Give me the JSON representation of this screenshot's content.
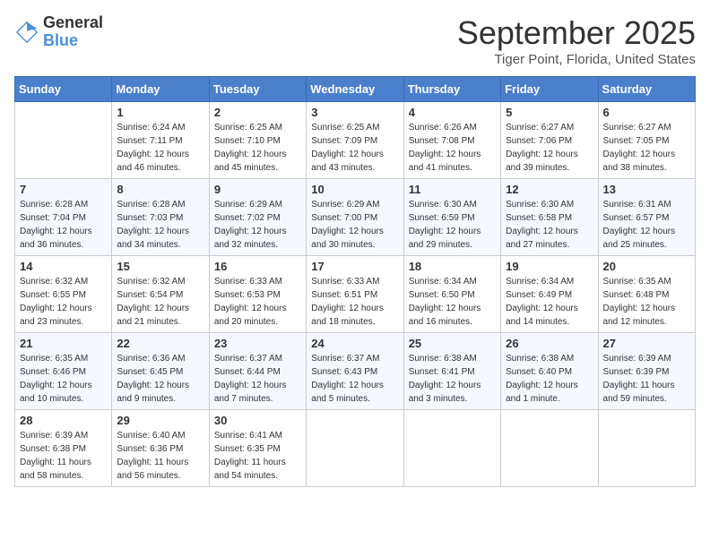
{
  "logo": {
    "general": "General",
    "blue": "Blue"
  },
  "header": {
    "month": "September 2025",
    "location": "Tiger Point, Florida, United States"
  },
  "weekdays": [
    "Sunday",
    "Monday",
    "Tuesday",
    "Wednesday",
    "Thursday",
    "Friday",
    "Saturday"
  ],
  "weeks": [
    [
      {
        "day": "",
        "info": ""
      },
      {
        "day": "1",
        "info": "Sunrise: 6:24 AM\nSunset: 7:11 PM\nDaylight: 12 hours\nand 46 minutes."
      },
      {
        "day": "2",
        "info": "Sunrise: 6:25 AM\nSunset: 7:10 PM\nDaylight: 12 hours\nand 45 minutes."
      },
      {
        "day": "3",
        "info": "Sunrise: 6:25 AM\nSunset: 7:09 PM\nDaylight: 12 hours\nand 43 minutes."
      },
      {
        "day": "4",
        "info": "Sunrise: 6:26 AM\nSunset: 7:08 PM\nDaylight: 12 hours\nand 41 minutes."
      },
      {
        "day": "5",
        "info": "Sunrise: 6:27 AM\nSunset: 7:06 PM\nDaylight: 12 hours\nand 39 minutes."
      },
      {
        "day": "6",
        "info": "Sunrise: 6:27 AM\nSunset: 7:05 PM\nDaylight: 12 hours\nand 38 minutes."
      }
    ],
    [
      {
        "day": "7",
        "info": "Sunrise: 6:28 AM\nSunset: 7:04 PM\nDaylight: 12 hours\nand 36 minutes."
      },
      {
        "day": "8",
        "info": "Sunrise: 6:28 AM\nSunset: 7:03 PM\nDaylight: 12 hours\nand 34 minutes."
      },
      {
        "day": "9",
        "info": "Sunrise: 6:29 AM\nSunset: 7:02 PM\nDaylight: 12 hours\nand 32 minutes."
      },
      {
        "day": "10",
        "info": "Sunrise: 6:29 AM\nSunset: 7:00 PM\nDaylight: 12 hours\nand 30 minutes."
      },
      {
        "day": "11",
        "info": "Sunrise: 6:30 AM\nSunset: 6:59 PM\nDaylight: 12 hours\nand 29 minutes."
      },
      {
        "day": "12",
        "info": "Sunrise: 6:30 AM\nSunset: 6:58 PM\nDaylight: 12 hours\nand 27 minutes."
      },
      {
        "day": "13",
        "info": "Sunrise: 6:31 AM\nSunset: 6:57 PM\nDaylight: 12 hours\nand 25 minutes."
      }
    ],
    [
      {
        "day": "14",
        "info": "Sunrise: 6:32 AM\nSunset: 6:55 PM\nDaylight: 12 hours\nand 23 minutes."
      },
      {
        "day": "15",
        "info": "Sunrise: 6:32 AM\nSunset: 6:54 PM\nDaylight: 12 hours\nand 21 minutes."
      },
      {
        "day": "16",
        "info": "Sunrise: 6:33 AM\nSunset: 6:53 PM\nDaylight: 12 hours\nand 20 minutes."
      },
      {
        "day": "17",
        "info": "Sunrise: 6:33 AM\nSunset: 6:51 PM\nDaylight: 12 hours\nand 18 minutes."
      },
      {
        "day": "18",
        "info": "Sunrise: 6:34 AM\nSunset: 6:50 PM\nDaylight: 12 hours\nand 16 minutes."
      },
      {
        "day": "19",
        "info": "Sunrise: 6:34 AM\nSunset: 6:49 PM\nDaylight: 12 hours\nand 14 minutes."
      },
      {
        "day": "20",
        "info": "Sunrise: 6:35 AM\nSunset: 6:48 PM\nDaylight: 12 hours\nand 12 minutes."
      }
    ],
    [
      {
        "day": "21",
        "info": "Sunrise: 6:35 AM\nSunset: 6:46 PM\nDaylight: 12 hours\nand 10 minutes."
      },
      {
        "day": "22",
        "info": "Sunrise: 6:36 AM\nSunset: 6:45 PM\nDaylight: 12 hours\nand 9 minutes."
      },
      {
        "day": "23",
        "info": "Sunrise: 6:37 AM\nSunset: 6:44 PM\nDaylight: 12 hours\nand 7 minutes."
      },
      {
        "day": "24",
        "info": "Sunrise: 6:37 AM\nSunset: 6:43 PM\nDaylight: 12 hours\nand 5 minutes."
      },
      {
        "day": "25",
        "info": "Sunrise: 6:38 AM\nSunset: 6:41 PM\nDaylight: 12 hours\nand 3 minutes."
      },
      {
        "day": "26",
        "info": "Sunrise: 6:38 AM\nSunset: 6:40 PM\nDaylight: 12 hours\nand 1 minute."
      },
      {
        "day": "27",
        "info": "Sunrise: 6:39 AM\nSunset: 6:39 PM\nDaylight: 11 hours\nand 59 minutes."
      }
    ],
    [
      {
        "day": "28",
        "info": "Sunrise: 6:39 AM\nSunset: 6:38 PM\nDaylight: 11 hours\nand 58 minutes."
      },
      {
        "day": "29",
        "info": "Sunrise: 6:40 AM\nSunset: 6:36 PM\nDaylight: 11 hours\nand 56 minutes."
      },
      {
        "day": "30",
        "info": "Sunrise: 6:41 AM\nSunset: 6:35 PM\nDaylight: 11 hours\nand 54 minutes."
      },
      {
        "day": "",
        "info": ""
      },
      {
        "day": "",
        "info": ""
      },
      {
        "day": "",
        "info": ""
      },
      {
        "day": "",
        "info": ""
      }
    ]
  ]
}
